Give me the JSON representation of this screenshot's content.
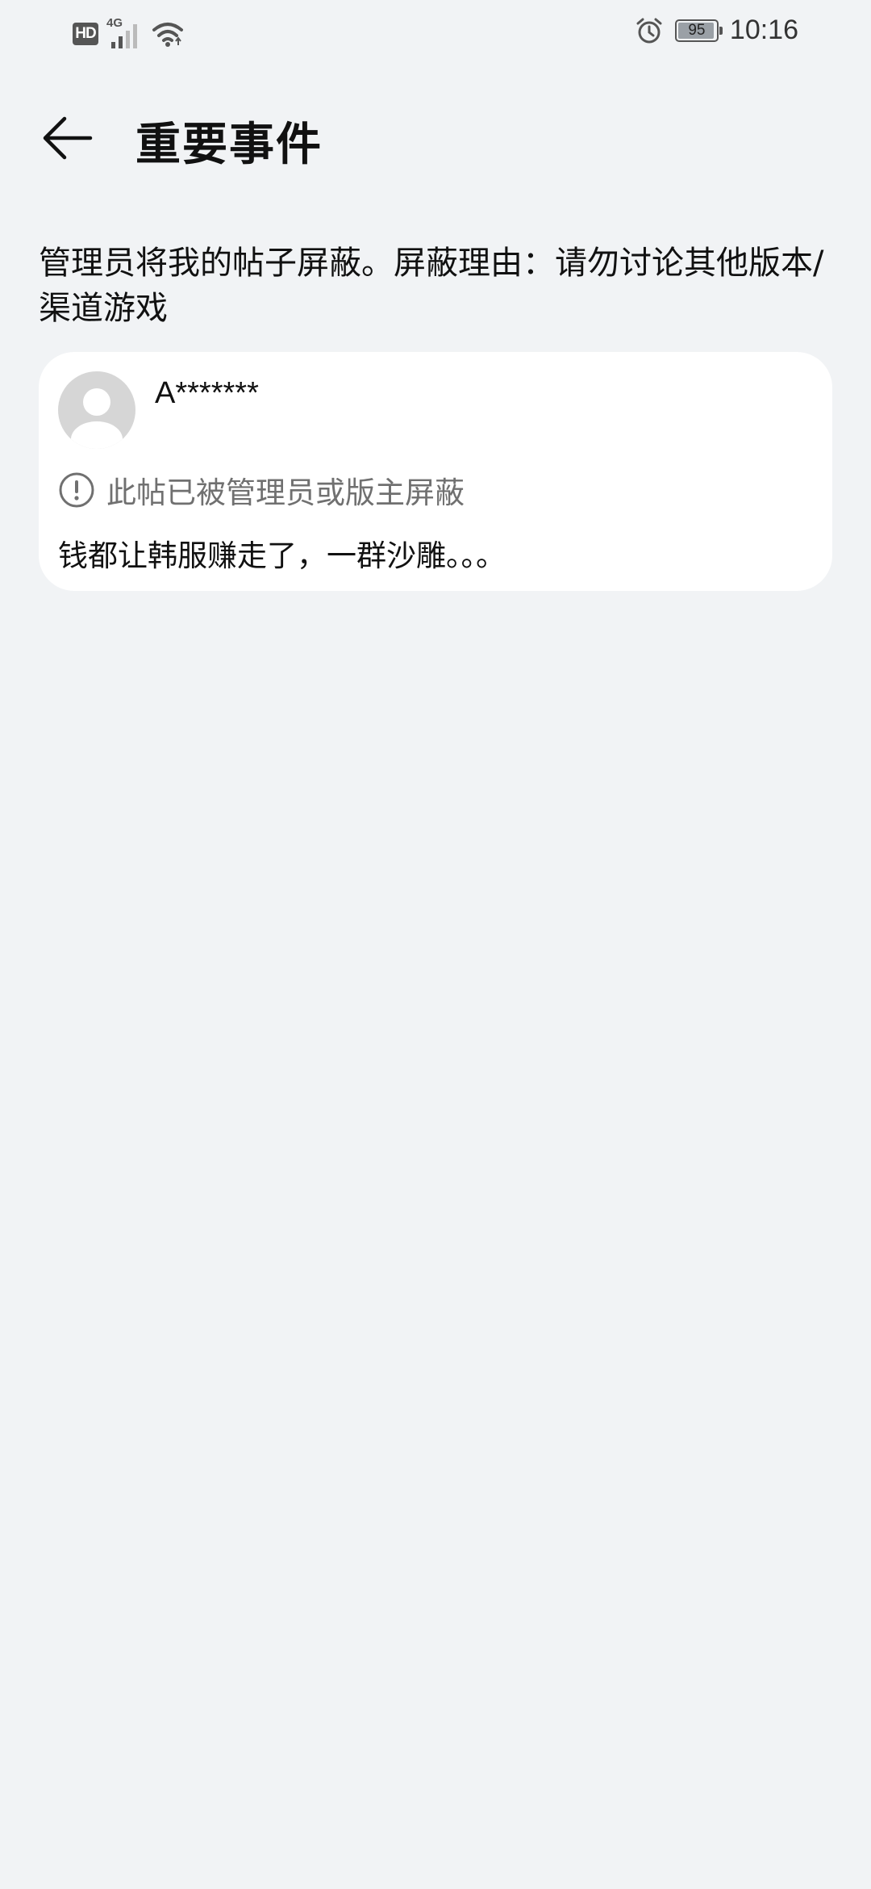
{
  "status_bar": {
    "hd_label": "HD",
    "network_label": "4G",
    "battery_level": "95",
    "battery_fraction": 0.95,
    "time": "10:16",
    "icons": [
      "hd-icon",
      "signal-icon",
      "wifi-icon",
      "alarm-icon",
      "battery-icon"
    ]
  },
  "header": {
    "back_icon": "arrow-left-icon",
    "title": "重要事件"
  },
  "event": {
    "description": "管理员将我的帖子屏蔽。屏蔽理由：请勿讨论其他版本/渠道游戏"
  },
  "post": {
    "avatar_icon": "default-avatar-icon",
    "username": "A*******",
    "notice_icon": "exclamation-circle-icon",
    "notice": "此帖已被管理员或版主屏蔽",
    "content": "钱都让韩服赚走了，一群沙雕。。。"
  },
  "colors": {
    "background": "#f1f3f5",
    "card": "#ffffff",
    "muted_text": "#707070",
    "primary_text": "#111111"
  }
}
